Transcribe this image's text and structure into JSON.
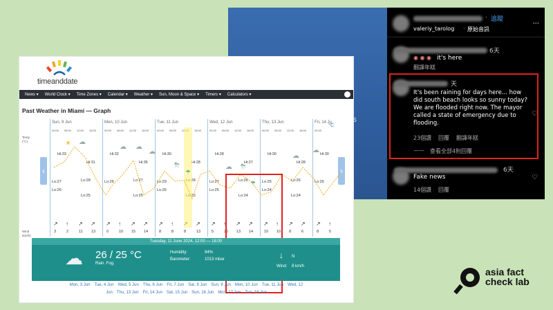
{
  "instagram": {
    "header_username": "valeriy_tarolog",
    "header_separator": "·",
    "header_original_audio": "原始音訊",
    "header_follow": "追蹤",
    "comment1": {
      "time": "6天",
      "text": "it's here",
      "translate": "翻譯年糕"
    },
    "comment2": {
      "time": "天",
      "text": "It's been raining for days here... how did south beach looks so sunny today? We are flooded right now. The mayor called a state of emergency due to flooding.",
      "likes": "23個讚",
      "reply": "回覆",
      "translate": "翻譯年糕",
      "view_replies": "查看全部4則回覆"
    },
    "comment3": {
      "time": "6天",
      "text": "Fake news",
      "likes": "14個讚",
      "reply": "回覆"
    }
  },
  "tad": {
    "logo": "timeanddate",
    "nav": [
      "News ▾",
      "World Clock ▾",
      "Time Zones ▾",
      "Calendar ▾",
      "Weather ▾",
      "Sun, Moon & Space ▾",
      "Timers ▾",
      "Calculators ▾"
    ],
    "page_title": "Past Weather in Miami — Graph",
    "unit": "°C",
    "days": [
      {
        "label": "Sun, 9 Jun",
        "hi": "Hi:33",
        "hi2": "Hi:31",
        "lo": "Lo:27",
        "lo2": "Lo:28",
        "lo3": "Lo:26",
        "lo4": "Lo:25",
        "wind": [
          "3",
          "2",
          "11",
          "13"
        ]
      },
      {
        "label": "Mon, 10 Jun",
        "hi": "Hi:32",
        "hi2": "Hi:35",
        "lo": "Lo:26",
        "lo2": "Lo:27",
        "lo3": "",
        "lo4": "Lo:25",
        "wind": [
          "0",
          "10",
          "15",
          "14"
        ]
      },
      {
        "label": "Tue, 11 Jun",
        "hi": "Hi:30",
        "hi2": "Hi:28",
        "lo": "Lo:29",
        "lo2": "Lo:28",
        "lo3": "Lo:26",
        "lo4": "Lo:25",
        "wind": [
          "8",
          "8",
          "8",
          "13"
        ]
      },
      {
        "label": "Wed, 12 Jun",
        "hi": "Hi:28",
        "hi2": "Hi:27",
        "lo": "Lo:27",
        "lo2": "Lo:26",
        "lo3": "Lo:25",
        "lo4": "Lo:24",
        "wind": [
          "5",
          "20",
          "13",
          "14"
        ]
      },
      {
        "label": "Thu, 13 Jun",
        "hi": "Hi:30",
        "hi2": "Hi:28",
        "lo": "Lo:25",
        "lo2": "Lo:26",
        "lo3": "Lo:24",
        "lo4": "Lo:24",
        "wind": [
          "10",
          "10",
          "8",
          "6"
        ]
      },
      {
        "label": "Fri, 14 Ju",
        "hi": "Hi:30",
        "hi2": "",
        "lo": "Lo:26",
        "lo2": "",
        "lo3": "",
        "lo4": "",
        "wind": [
          "8",
          "5"
        ]
      }
    ],
    "hours": [
      "00:00",
      "06:00",
      "12:00",
      "18:00"
    ],
    "temp_label": "Temp (°C)",
    "wind_label": "Wind (km/h)",
    "info": {
      "time": "Tuesday, 11 June 2024, 12:00 — 18:00",
      "temp": "26 / 25 °C",
      "desc": "Rain. Fog.",
      "humidity_label": "Humidity:",
      "humidity": "94%",
      "barometer_label": "Barometer:",
      "barometer": "1013 mbar",
      "wind_dir": "N",
      "wind_label": "Wind:",
      "wind": "8 km/h"
    },
    "dates_row1": [
      "Mon, 3 Jun",
      "Tue, 4 Jun",
      "Wed, 5 Jun",
      "Thu, 6 Jun",
      "Fri, 7 Jun",
      "Sat, 8 Jun",
      "Sun, 9 Jun",
      "Mon, 10 Jun",
      "Tue, 11 Jun",
      "Wed, 12"
    ],
    "dates_row2": [
      "Jun",
      "Thu, 13 Jun",
      "Fri, 14 Jun",
      "Sat, 15 Jun",
      "Sun, 16 Jun",
      "Mon, 17 Jun",
      "Tue, 18 Jun"
    ]
  },
  "watermark": {
    "line1": "asia fact",
    "line2": "check lab"
  },
  "colors": {
    "highlight": "#e0211c",
    "teal": "#1f8f8b",
    "nav": "#2b2f36"
  }
}
